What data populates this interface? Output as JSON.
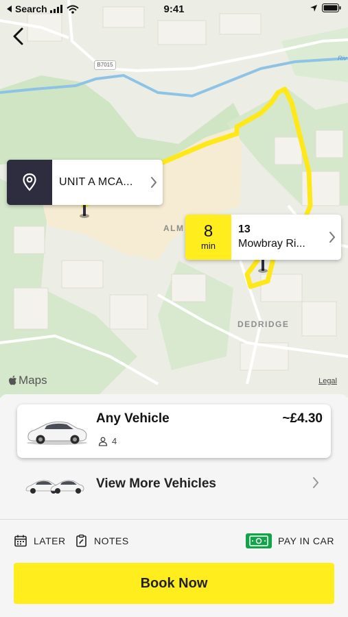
{
  "status_bar": {
    "back_app": "Search",
    "time": "9:41"
  },
  "map": {
    "road_label": "B7015",
    "river_label": "Riv",
    "area_labels": [
      "ALM",
      "DEDRIDGE"
    ],
    "maps_brand": "Maps",
    "legal": "Legal",
    "route_color": "#ffe81a"
  },
  "pickup": {
    "label": "UNIT A MCA..."
  },
  "dropoff": {
    "eta_value": "8",
    "eta_unit": "min",
    "line1": "13",
    "line2": "Mowbray Ri..."
  },
  "vehicle": {
    "title": "Any Vehicle",
    "price": "~£4.30",
    "seats": "4"
  },
  "more_vehicles": {
    "label": "View More Vehicles"
  },
  "options": {
    "later": "LATER",
    "notes": "NOTES",
    "pay": "PAY IN CAR"
  },
  "book_button": "Book Now",
  "colors": {
    "accent": "#ffed1e",
    "dark": "#2d2d3f",
    "cash": "#14a34a"
  }
}
